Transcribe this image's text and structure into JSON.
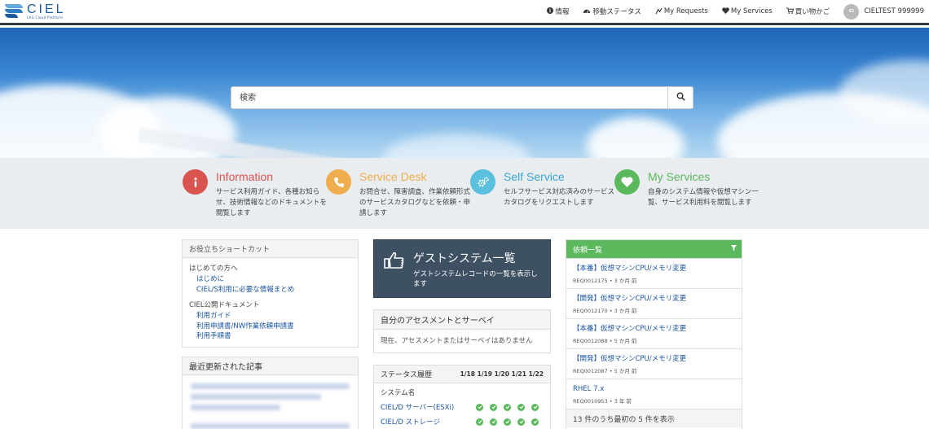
{
  "header": {
    "logo_title": "CIEL",
    "logo_sub": "LAG Cloud Platform",
    "nav": [
      {
        "label": "情報",
        "icon": "info-icon"
      },
      {
        "label": "移動ステータス",
        "icon": "dashboard-icon"
      },
      {
        "label": "My Requests",
        "icon": "request-icon"
      },
      {
        "label": "My Services",
        "icon": "heart-icon"
      },
      {
        "label": "買い物かご",
        "icon": "cart-icon"
      }
    ],
    "user": {
      "initials": "CI",
      "name": "CIELTEST 999999"
    }
  },
  "hero": {
    "search_placeholder": "検索"
  },
  "categories": [
    {
      "title": "Information",
      "desc": "サービス利用ガイド、各種お知らせ、技術情報などのドキュメントを閲覧します",
      "color": "#d9534f",
      "title_color": "#d9534f",
      "icon": "info-icon"
    },
    {
      "title": "Service Desk",
      "desc": "お問合せ、障害調査、作業依頼形式のサービスカタログなどを依頼・申請します",
      "color": "#f0ad4e",
      "title_color": "#f0ad4e",
      "icon": "phone-icon"
    },
    {
      "title": "Self Service",
      "desc": "セルフサービス対応済みのサービスカタログをリクエストします",
      "color": "#5bc0de",
      "title_color": "#3aa7cf",
      "icon": "gears-icon"
    },
    {
      "title": "My Services",
      "desc": "自身のシステム情報や仮想マシン一覧、サービス利用料を閲覧します",
      "color": "#5cb85c",
      "title_color": "#5cb85c",
      "icon": "heart-icon"
    }
  ],
  "shortcuts": {
    "title": "お役立ちショートカット",
    "groups": [
      {
        "label": "はじめての方へ",
        "links": [
          "はじめに",
          "CIEL/S利用に必要な情報まとめ"
        ]
      },
      {
        "label": "CIEL公開ドキュメント",
        "links": [
          "利用ガイド",
          "利用申請書/NW作業依頼申請書",
          "利用手順書"
        ]
      }
    ]
  },
  "articles": {
    "title": "最近更新された記事"
  },
  "guest": {
    "title": "ゲストシステム一覧",
    "desc": "ゲストシステムレコードの一覧を表示します"
  },
  "assessment": {
    "title": "自分のアセスメントとサーベイ",
    "empty": "現在、アセスメントまたはサーベイはありません"
  },
  "status": {
    "title": "ステータス履歴",
    "dates": "1/18 1/19 1/20 1/21 1/22",
    "col_label": "システム名",
    "rows": [
      {
        "name": "CIEL/D サーバー(ESXi)",
        "status": [
          "ok",
          "ok",
          "ok",
          "ok",
          "ok"
        ]
      },
      {
        "name": "CIEL/D ストレージ",
        "status": [
          "ok",
          "ok",
          "ok",
          "ok",
          "ok"
        ]
      }
    ]
  },
  "requests": {
    "title": "依頼一覧",
    "items": [
      {
        "title": "【本番】仮想マシンCPU/メモリ変更",
        "meta": "REQ0012175 • 3 か月 前"
      },
      {
        "title": "【開発】仮想マシンCPU/メモリ変更",
        "meta": "REQ0012170 • 3 か月 前"
      },
      {
        "title": "【本番】仮想マシンCPU/メモリ変更",
        "meta": "REQ0012088 • 5 か月 前"
      },
      {
        "title": "【開発】仮想マシンCPU/メモリ変更",
        "meta": "REQ0012087 • 5 か月 前"
      },
      {
        "title": "RHEL 7.x",
        "meta": "REQ0010953 • 3 年 前"
      }
    ],
    "footer": "13 件のうち最初の 5 件を表示"
  },
  "colors": {
    "accent": "#1a55a0",
    "header_border": "#2c3a48",
    "green": "#5cb85c",
    "guest_bg": "#3e5162"
  }
}
